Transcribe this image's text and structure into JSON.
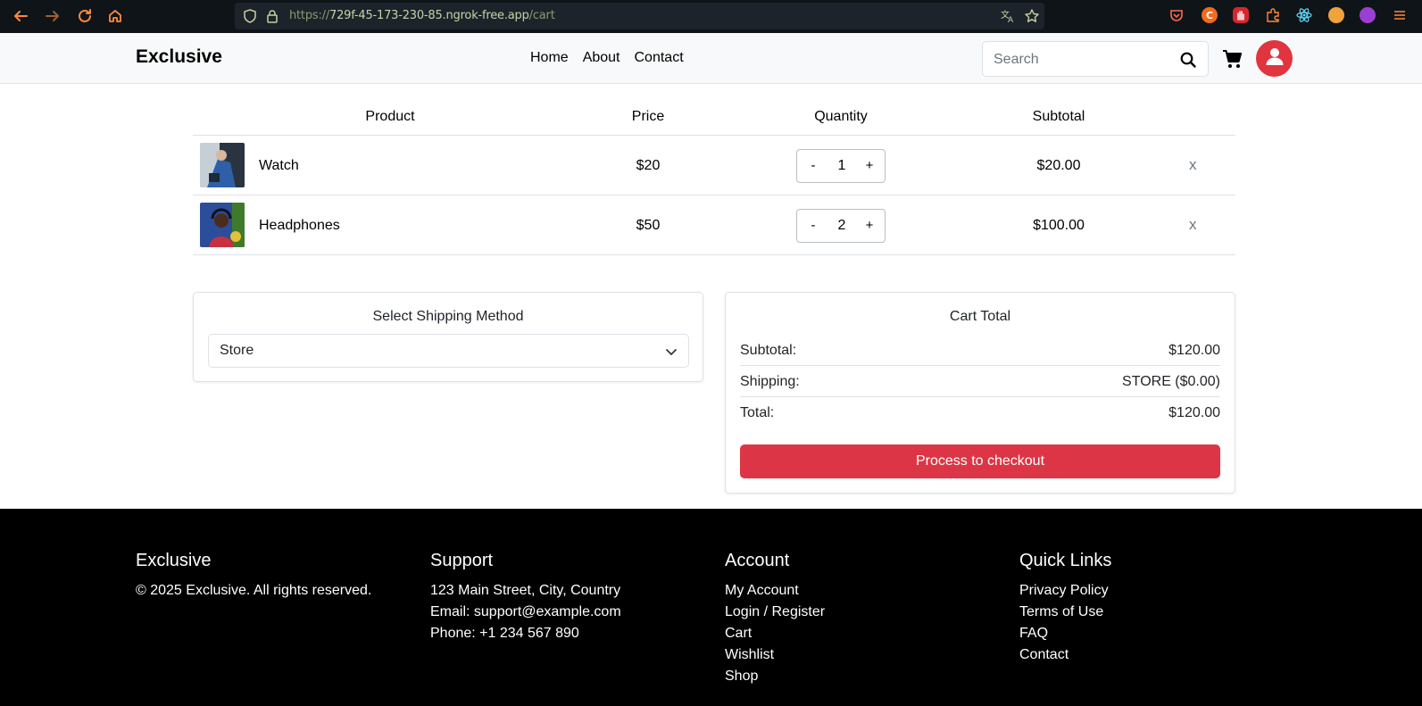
{
  "browser": {
    "url_protocol": "https://",
    "url_host": "729f-45-173-230-85.ngrok-free.app",
    "url_path": "/cart"
  },
  "header": {
    "brand": "Exclusive",
    "nav": [
      "Home",
      "About",
      "Contact"
    ],
    "search_placeholder": "Search"
  },
  "cart": {
    "columns": [
      "Product",
      "Price",
      "Quantity",
      "Subtotal"
    ],
    "items": [
      {
        "name": "Watch",
        "price": "$20",
        "quantity": "1",
        "subtotal": "$20.00",
        "remove": "x"
      },
      {
        "name": "Headphones",
        "price": "$50",
        "quantity": "2",
        "subtotal": "$100.00",
        "remove": "x"
      }
    ],
    "minus_label": "-",
    "plus_label": "+"
  },
  "shipping": {
    "title": "Select Shipping Method",
    "selected": "Store"
  },
  "totals": {
    "title": "Cart Total",
    "subtotal_label": "Subtotal:",
    "subtotal_value": "$120.00",
    "shipping_label": "Shipping:",
    "shipping_value": "STORE ($0.00)",
    "total_label": "Total:",
    "total_value": "$120.00",
    "checkout_label": "Process to checkout"
  },
  "footer": {
    "brand": {
      "title": "Exclusive",
      "copyright": "© 2025 Exclusive. All rights reserved."
    },
    "support": {
      "title": "Support",
      "address": "123 Main Street, City, Country",
      "email": "Email: support@example.com",
      "phone": "Phone: +1 234 567 890"
    },
    "account": {
      "title": "Account",
      "links": [
        "My Account",
        "Login / Register",
        "Cart",
        "Wishlist",
        "Shop"
      ]
    },
    "quick_links": {
      "title": "Quick Links",
      "links": [
        "Privacy Policy",
        "Terms of Use",
        "FAQ",
        "Contact"
      ]
    }
  },
  "colors": {
    "accent": "#dc3545",
    "footer_bg": "#000000",
    "header_bg": "#f8f9fa"
  }
}
